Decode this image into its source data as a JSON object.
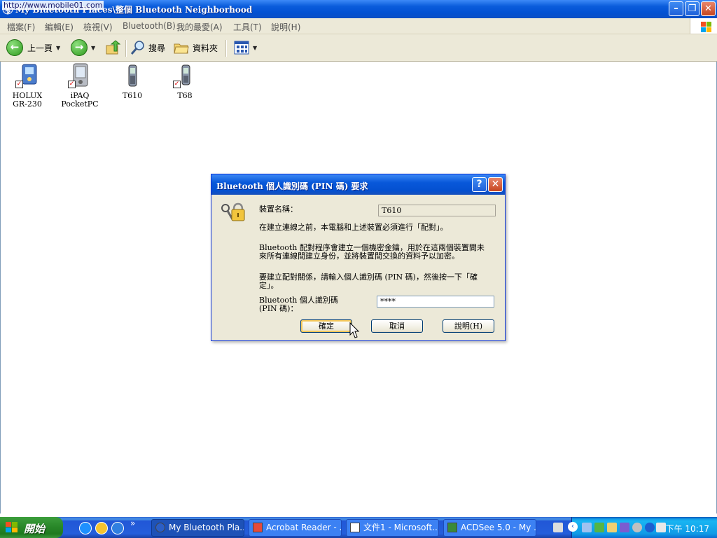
{
  "window": {
    "watermark": "http://www.mobile01.com",
    "title": "My Bluetooth Places\\整個 Bluetooth Neighborhood"
  },
  "menu": [
    "檔案(F)",
    "編輯(E)",
    "檢視(V)",
    "Bluetooth(B)",
    "我的最愛(A)",
    "工具(T)",
    "說明(H)"
  ],
  "toolbar": {
    "back_label": "上一頁",
    "search_label": "搜尋",
    "folders_label": "資料夾"
  },
  "devices": [
    {
      "label": "HOLUX\nGR-230"
    },
    {
      "label": "iPAQ\nPocketPC"
    },
    {
      "label": "T610"
    },
    {
      "label": "T68"
    }
  ],
  "dialog": {
    "title": "Bluetooth 個人識別碼 (PIN 碼) 要求",
    "device_name_label": "裝置名稱：",
    "device_name_value": "T610",
    "para1": "在建立連線之前，本電腦和上述裝置必須進行「配對」。",
    "para2": "Bluetooth 配對程序會建立一個機密金鑰，用於在這兩個裝置間未\n來所有連線間建立身份，並將裝置間交換的資料予以加密。",
    "para3": "要建立配對關係，請輸入個人識別碼 (PIN 碼)，然後按一下「確\n定」。",
    "pin_label": "Bluetooth 個人識別碼\n(PIN 碼)：",
    "pin_value": "****",
    "ok_label": "確定",
    "cancel_label": "取消",
    "help_label": "說明(H)"
  },
  "taskbar": {
    "start_label": "開始",
    "chevron": "»",
    "tasks": [
      {
        "label": "My Bluetooth Pla..."
      },
      {
        "label": "Acrobat Reader - ..."
      },
      {
        "label": "文件1 - Microsoft..."
      },
      {
        "label": "ACDSee 5.0 - My ..."
      }
    ],
    "clock": "下午 10:17"
  }
}
